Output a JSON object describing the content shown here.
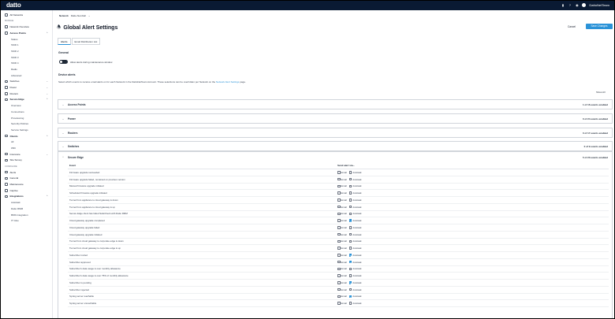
{
  "brand": {
    "logo": "datto",
    "user": "DattoNetTeam"
  },
  "network_bar": {
    "label": "Network",
    "value": "Datto-Net-Dell"
  },
  "page": {
    "title": "Global Alert Settings",
    "cancel": "Cancel",
    "save": "Save Changes"
  },
  "tabs": [
    "Alerts",
    "Email Distribution List"
  ],
  "general": {
    "heading": "General",
    "toggle_label": "Allow alerts during maintenance window"
  },
  "device": {
    "heading": "Device alerts",
    "desc": "Select which events to receive email alerts on for each Network in the DattoNetTeam Account. These selections can be overridden per Network on the",
    "link": "Network Alert Settings",
    "desc_end": "page.",
    "show_all": "Show All"
  },
  "sidebar": [
    {
      "label": "All Networks",
      "type": "top",
      "icon": "globe-icon"
    },
    {
      "label": "MANAGE",
      "type": "head"
    },
    {
      "label": "Network Overview",
      "type": "top",
      "icon": "network-icon"
    },
    {
      "label": "Access Points",
      "type": "top",
      "icon": "wifi-icon",
      "bold": true,
      "chev": "⌃"
    },
    {
      "label": "Status",
      "type": "sub"
    },
    {
      "label": "SSID 1",
      "type": "sub"
    },
    {
      "label": "SSID 2",
      "type": "sub"
    },
    {
      "label": "SSID 3",
      "type": "sub"
    },
    {
      "label": "SSID 4",
      "type": "sub"
    },
    {
      "label": "Radio",
      "type": "sub"
    },
    {
      "label": "Advanced",
      "type": "sub"
    },
    {
      "label": "Switches",
      "type": "top",
      "icon": "switch-icon",
      "chev": "⌄"
    },
    {
      "label": "Power",
      "type": "top",
      "icon": "power-icon",
      "chev": "⌄"
    },
    {
      "label": "Routers",
      "type": "top",
      "icon": "router-icon",
      "chev": "⌄"
    },
    {
      "label": "Secure Edge",
      "type": "top",
      "icon": "shield-icon",
      "bold": true,
      "chev": "⌃"
    },
    {
      "label": "Overview",
      "type": "sub"
    },
    {
      "label": "Connections",
      "type": "sub"
    },
    {
      "label": "Provisioning",
      "type": "sub"
    },
    {
      "label": "Security Policies",
      "type": "sub"
    },
    {
      "label": "Service Settings",
      "type": "sub"
    },
    {
      "label": "Clients",
      "type": "top",
      "icon": "clients-icon",
      "bold": true,
      "chev": "⌃"
    },
    {
      "label": "All",
      "type": "sub"
    },
    {
      "label": "WiFi",
      "type": "sub"
    },
    {
      "label": "Insurance",
      "type": "top",
      "icon": "insurance-icon",
      "chev": "⌄"
    },
    {
      "label": "Site Survey",
      "type": "top",
      "icon": "survey-icon"
    },
    {
      "label": "CONFIGURE",
      "type": "head"
    },
    {
      "label": "Alerts",
      "type": "top",
      "icon": "bell-icon"
    },
    {
      "label": "General",
      "type": "top",
      "icon": "gear-icon"
    },
    {
      "label": "Maintenance",
      "type": "top",
      "icon": "wrench-icon"
    },
    {
      "label": "Captive",
      "type": "top",
      "icon": "portal-icon"
    },
    {
      "label": "Integrations",
      "type": "top",
      "icon": "plug-icon",
      "bold": true,
      "chev": "⌃"
    },
    {
      "label": "Autotask",
      "type": "sub"
    },
    {
      "label": "Datto RMM",
      "type": "sub"
    },
    {
      "label": "BMS Integration",
      "type": "sub"
    },
    {
      "label": "IT Glue",
      "type": "sub"
    }
  ],
  "accordions": [
    {
      "name": "Access Points",
      "count": "1 of 16 events enabled"
    },
    {
      "name": "Power",
      "count": "0 of 24 events enabled"
    },
    {
      "name": "Routers",
      "count": "0 of 17 events enabled"
    },
    {
      "name": "Switches",
      "count": "0 of 9 events enabled"
    }
  ],
  "secure_edge": {
    "name": "Secure Edge",
    "count": "5 of 20 events enabled",
    "col_event": "Event",
    "col_send": "Send alert via...",
    "email_label": "Email",
    "autotask_label": "Autotask",
    "events": [
      {
        "name": "Firmware upgrade succeeded",
        "email": false,
        "autotask": false
      },
      {
        "name": "Firmware upgrade failed, remained on previous version",
        "email": false,
        "autotask": false
      },
      {
        "name": "Manual firmware upgrade initiated",
        "email": false,
        "autotask": false
      },
      {
        "name": "Scheduled firmware upgrade initiated",
        "email": false,
        "autotask": false
      },
      {
        "name": "Tunnel from appliance to cloud gateway is down",
        "email": false,
        "autotask": false
      },
      {
        "name": "Tunnel from appliance to cloud gateway is up",
        "email": false,
        "autotask": false
      },
      {
        "name": "Secure Edge client has failed SafeCheck with Datto RMM",
        "email": false,
        "autotask": false
      },
      {
        "name": "Cloud gateway upgrade completed",
        "email": false,
        "autotask": true
      },
      {
        "name": "Cloud gateway upgrade failed",
        "email": false,
        "autotask": false
      },
      {
        "name": "Cloud gateway upgrade initiated",
        "email": false,
        "autotask": false
      },
      {
        "name": "Tunnel from cloud gateway to corporate edge is down",
        "email": false,
        "autotask": false
      },
      {
        "name": "Tunnel from cloud gateway to corporate edge is up",
        "email": false,
        "autotask": false
      },
      {
        "name": "Subscriber invited",
        "email": false,
        "autotask": true
      },
      {
        "name": "Subscriber approved",
        "email": false,
        "autotask": true
      },
      {
        "name": "Subscriber's data usage is over monthly allowance",
        "email": false,
        "autotask": false
      },
      {
        "name": "Subscriber's data usage is over 75% of monthly allowance",
        "email": false,
        "autotask": false
      },
      {
        "name": "Subscriber is pending",
        "email": false,
        "autotask": true
      },
      {
        "name": "Subscriber rejected",
        "email": false,
        "autotask": false
      },
      {
        "name": "Syslog server reachable",
        "email": false,
        "autotask": true
      },
      {
        "name": "Syslog server unreachable",
        "email": false,
        "autotask": false
      }
    ]
  },
  "colors": {
    "accent": "#2b93d8",
    "topbar": "#0a1a33"
  }
}
